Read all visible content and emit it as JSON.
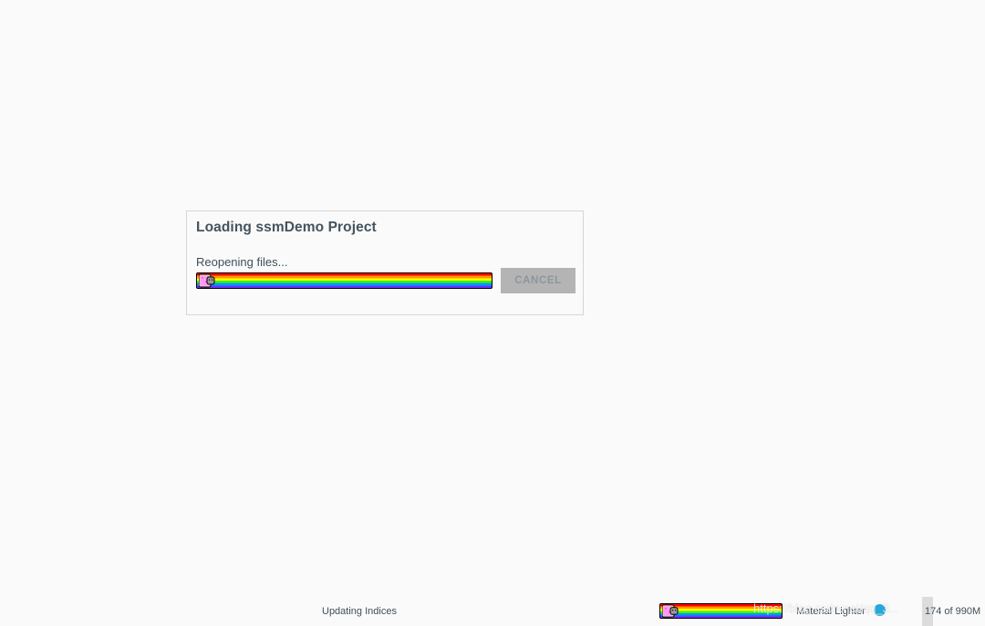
{
  "dialog": {
    "title": "Loading ssmDemo Project",
    "status": "Reopening files...",
    "progress": 1.0,
    "cancel_label": "CANCEL"
  },
  "status_bar": {
    "task_text": "Updating Indices",
    "task_progress": 1.0,
    "theme_label": "Material Lighter",
    "memory_label": "174 of 990M",
    "memory_fraction": 0.176,
    "watermark": "https://blog.csdn.net/qq_3..."
  },
  "icons": {
    "progress_icon": "nyan-cat-icon",
    "theme_icon": "theme-dot-icon"
  },
  "colors": {
    "background": "#fafafa",
    "dialog_border": "#d6d6d6",
    "text": "#3f4f5a",
    "cancel_bg": "#b4b4b4",
    "cancel_text": "#8e969b",
    "theme_dot": "#26a9d9",
    "rainbow": [
      "#ff0000",
      "#ff9900",
      "#ffff00",
      "#33ff00",
      "#0099ff",
      "#6633ff"
    ]
  }
}
